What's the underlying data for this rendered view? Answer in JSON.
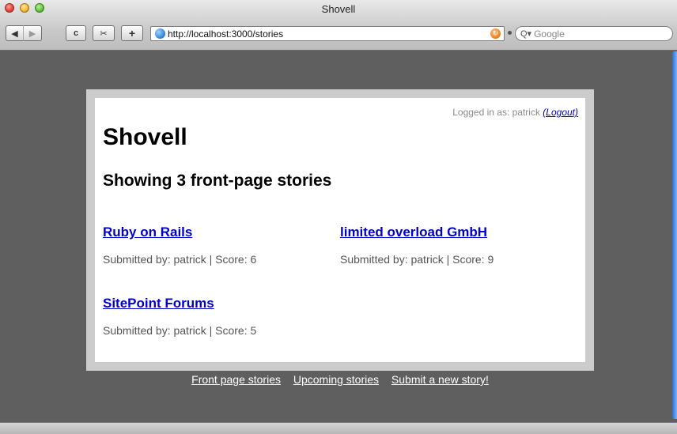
{
  "window": {
    "title": "Shovell"
  },
  "toolbar": {
    "back_glyph": "◀",
    "forward_glyph": "▶",
    "reload_glyph": "c",
    "snip_glyph": "✂",
    "add_glyph": "+",
    "url": "http://localhost:3000/stories",
    "rss_glyph": "↻",
    "search_glyph": "Q▾",
    "search_placeholder": "Google"
  },
  "page": {
    "logged_in_text": "Logged in as: patrick ",
    "logout_label": "(Logout)",
    "site_title": "Shovell",
    "heading": "Showing 3 front-page stories",
    "stories": [
      {
        "title": "Ruby on Rails",
        "meta": "Submitted by: patrick | Score: 6"
      },
      {
        "title": "limited overload GmbH",
        "meta": "Submitted by: patrick | Score: 9"
      },
      {
        "title": "SitePoint Forums",
        "meta": "Submitted by: patrick | Score: 5"
      }
    ],
    "footer_links": [
      "Front page stories",
      "Upcoming stories",
      "Submit a new story!"
    ]
  }
}
